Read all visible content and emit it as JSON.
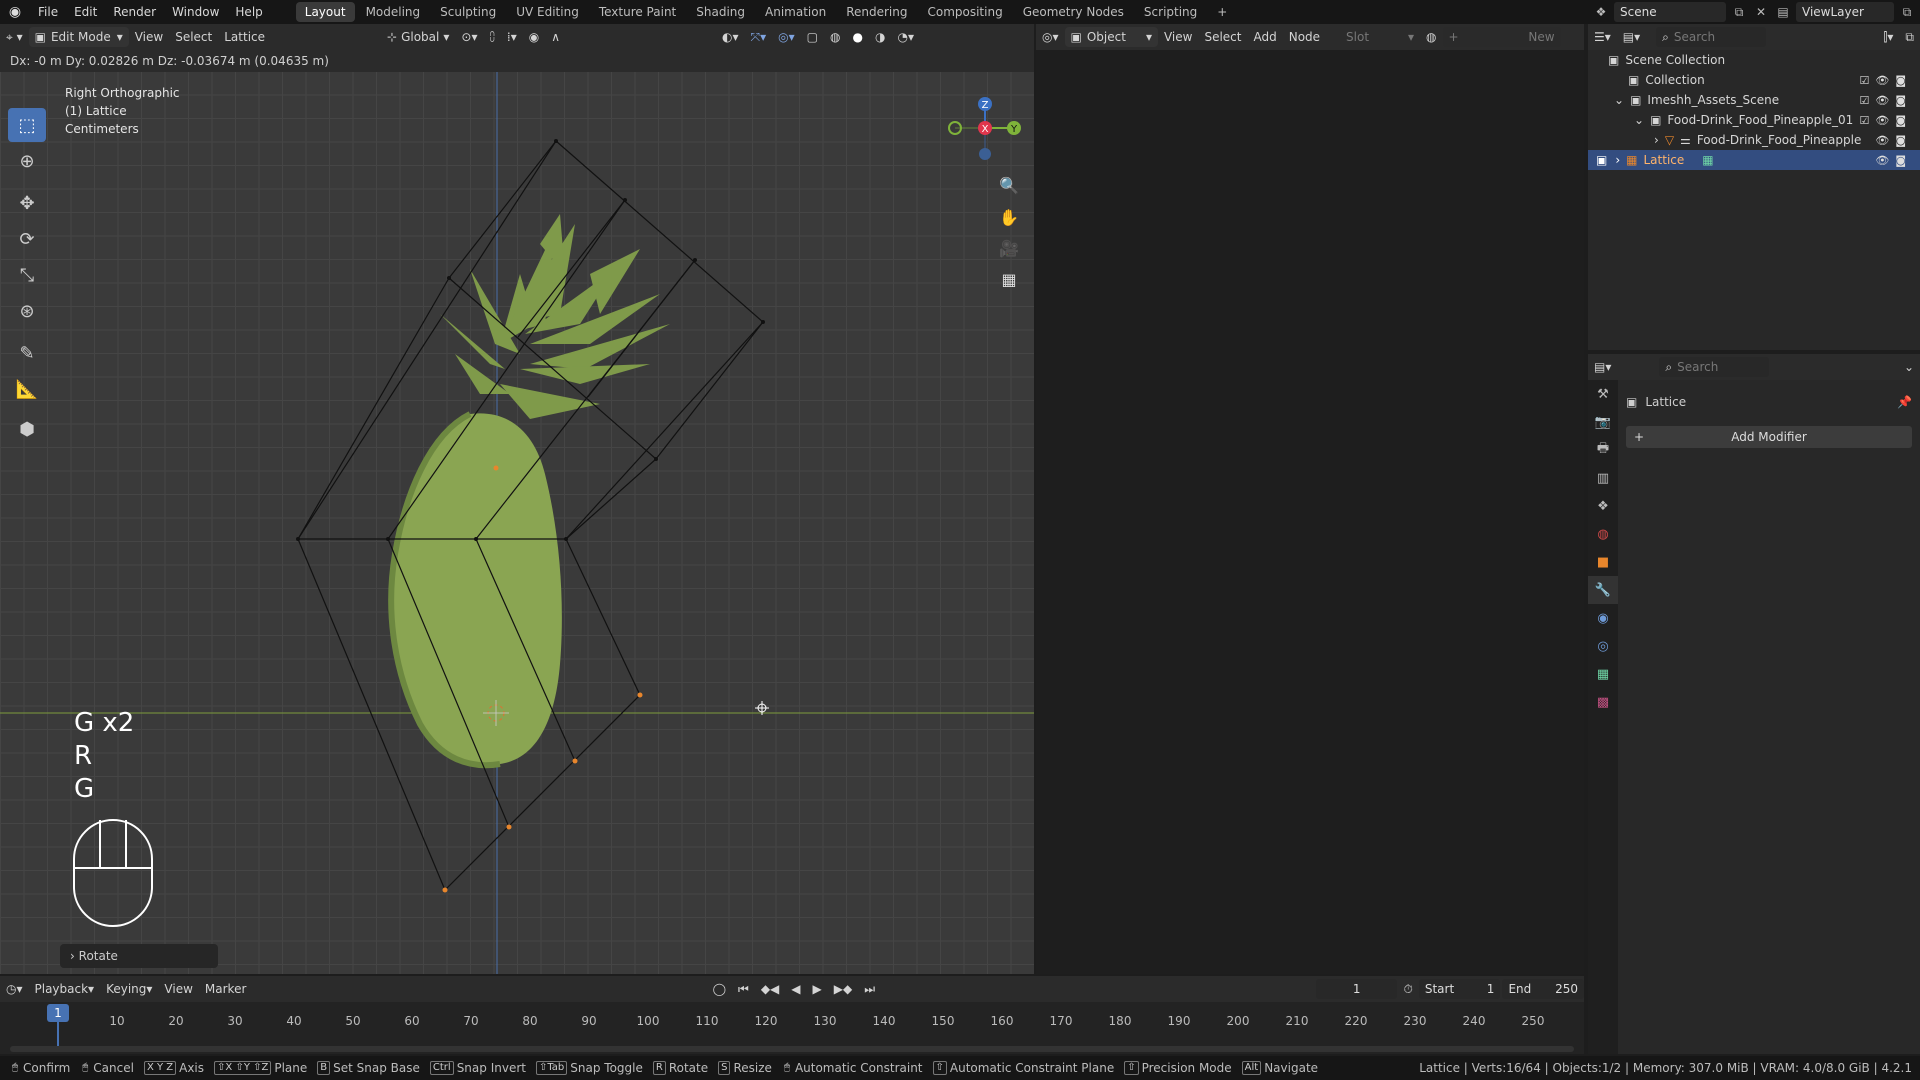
{
  "topbar": {
    "menus": [
      "File",
      "Edit",
      "Render",
      "Window",
      "Help"
    ],
    "workspaces": [
      "Layout",
      "Modeling",
      "Sculpting",
      "UV Editing",
      "Texture Paint",
      "Shading",
      "Animation",
      "Rendering",
      "Compositing",
      "Geometry Nodes",
      "Scripting"
    ],
    "active_workspace": "Layout",
    "scene": "Scene",
    "view_layer": "ViewLayer"
  },
  "viewport": {
    "mode": "Edit Mode",
    "menus": [
      "View",
      "Select",
      "Lattice"
    ],
    "orientation": "Global",
    "status": "Dx: -0 m   Dy: 0.02826 m   Dz: -0.03674 m (0.04635 m)",
    "view_name": "Right Orthographic",
    "object": "(1) Lattice",
    "units": "Centimeters",
    "keys": [
      "G x2",
      "R",
      "G"
    ],
    "last_op": "Rotate",
    "gizmo": {
      "z": "Z",
      "x": "X",
      "y": "Y"
    }
  },
  "node_editor": {
    "object_mode": "Object",
    "menus": [
      "View",
      "Select",
      "Add",
      "Node"
    ],
    "slot": "Slot",
    "new_btn": "New"
  },
  "outliner": {
    "search_placeholder": "Search",
    "rows": [
      {
        "label": "Scene Collection",
        "indent": 0
      },
      {
        "label": "Collection",
        "indent": 1
      },
      {
        "label": "Imeshh_Assets_Scene",
        "indent": 1
      },
      {
        "label": "Food-Drink_Food_Pineapple_01",
        "indent": 2
      },
      {
        "label": "Food-Drink_Food_Pineapple",
        "indent": 3
      },
      {
        "label": "Lattice",
        "indent": 1
      }
    ]
  },
  "properties": {
    "search_placeholder": "Search",
    "object_name": "Lattice",
    "add_modifier": "Add Modifier"
  },
  "timeline": {
    "menus": [
      "Playback",
      "Keying",
      "View",
      "Marker"
    ],
    "current_frame": "1",
    "start_label": "Start",
    "start": "1",
    "end_label": "End",
    "end": "250",
    "frames": [
      "10",
      "20",
      "30",
      "40",
      "50",
      "60",
      "70",
      "80",
      "90",
      "100",
      "110",
      "120",
      "130",
      "140",
      "150",
      "160",
      "170",
      "180",
      "190",
      "200",
      "210",
      "220",
      "230",
      "240",
      "250"
    ],
    "playhead": "1"
  },
  "statusbar": {
    "hints": [
      "Confirm",
      "Cancel",
      "Axis",
      "Plane",
      "Set Snap Base",
      "Snap Invert",
      "Snap Toggle",
      "Rotate",
      "Resize",
      "Automatic Constraint",
      "Automatic Constraint Plane",
      "Precision Mode",
      "Navigate"
    ],
    "keys": [
      "",
      "",
      "X Y Z",
      "⇧X ⇧Y ⇧Z",
      "B",
      "Ctrl",
      "⇧Tab",
      "R",
      "S",
      "",
      "⇧",
      "⇧",
      "Alt"
    ],
    "info": "Lattice | Verts:16/64 | Objects:1/2 | Memory: 307.0 MiB | VRAM: 4.0/8.0 GiB | 4.2.1"
  },
  "colors": {
    "accent": "#4772b3",
    "lattice_vertex": "#e8862c",
    "pineapple": "#8aa552"
  }
}
